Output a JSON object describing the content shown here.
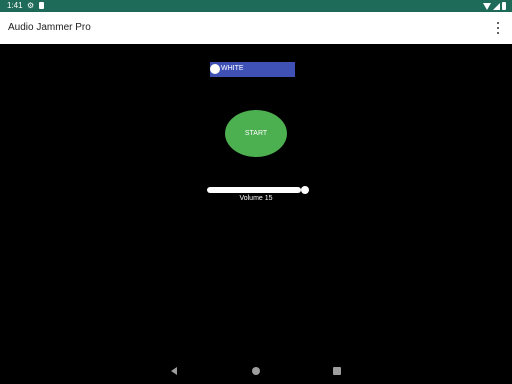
{
  "status_bar": {
    "time": "1:41",
    "icons": [
      "settings-icon",
      "sd-card-icon",
      "wifi-icon",
      "signal-icon",
      "battery-icon"
    ],
    "background": "#1f6b5a"
  },
  "app_bar": {
    "title": "Audio Jammer Pro",
    "menu_icon": "overflow-menu-icon"
  },
  "noise_toggle": {
    "label": "WHITE",
    "color": "#3f51b5"
  },
  "start_button": {
    "label": "START",
    "color": "#4caf50"
  },
  "volume": {
    "label": "Volume 15",
    "value": 15,
    "level_fraction": 1.0
  },
  "nav_bar": {
    "icons": [
      "back-icon",
      "home-icon",
      "recents-icon"
    ]
  }
}
